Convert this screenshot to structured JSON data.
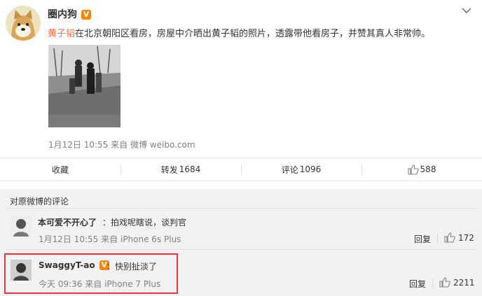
{
  "post": {
    "author": "圈内狗",
    "verified_badge": "V",
    "mention": "黄子韬",
    "text": "在北京朝阳区看房，房屋中介晒出黄子韬的照片，透露带他看房子，并赞其真人非常帅。",
    "time": "1月12日 10:55",
    "source_prefix": "来自",
    "source": "微博 weibo.com",
    "avatar_icon": "shiba-dog-avatar",
    "menu_icon": "chevron-down-icon"
  },
  "actions": {
    "favorite_label": "收藏",
    "repost_label": "转发",
    "repost_count": "1684",
    "comment_label": "评论",
    "comment_count": "1096",
    "like_count": "588",
    "like_icon": "thumbs-up-icon"
  },
  "comments_section": {
    "title": "对原微博的评论",
    "items": [
      {
        "name": "本可爱不开心了",
        "text": "：拍戏呢瞎说，谈判官",
        "time": "1月12日 10:55",
        "source_prefix": "来自",
        "source": "iPhone 6s Plus",
        "reply_label": "回复",
        "likes": "172",
        "verified": false
      },
      {
        "name": "SwaggyT-ao",
        "verified_badge": "V",
        "text": "：快别扯淡了",
        "time": "今天 09:36",
        "source_prefix": "来自",
        "source": "iPhone 7 Plus",
        "reply_label": "回复",
        "likes": "2211",
        "verified": true
      }
    ]
  },
  "colors": {
    "accent": "#eb7350",
    "badge": "#ff8200",
    "highlight": "#e23a3a",
    "comments_bg": "#f2f2f5"
  }
}
